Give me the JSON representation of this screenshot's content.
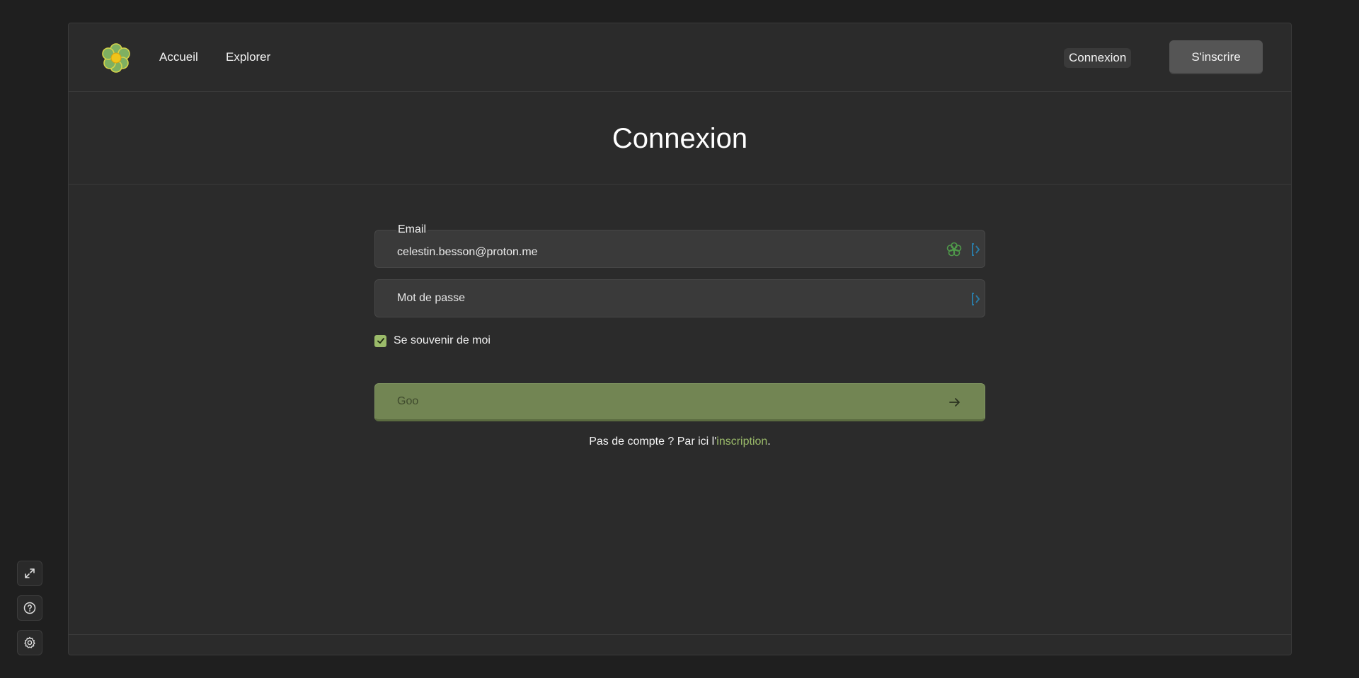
{
  "nav": {
    "home": "Accueil",
    "explore": "Explorer",
    "login": "Connexion",
    "signup": "S'inscrire"
  },
  "page": {
    "title": "Connexion"
  },
  "form": {
    "email": {
      "label": "Email",
      "value": "celestin.besson@proton.me"
    },
    "password": {
      "placeholder": "Mot de passe",
      "value": ""
    },
    "remember": {
      "label": "Se souvenir de moi",
      "checked": true
    },
    "submit_label": "Goo"
  },
  "signup_hint": {
    "prefix": "Pas de compte ? Par ici l'",
    "link": "inscription",
    "suffix": "."
  },
  "icons": {
    "logo": "flower-logo-icon",
    "password_manager": "flower-icon",
    "autofill": "bracket-icon",
    "submit": "arrow-right-icon",
    "tools": [
      "expand-icon",
      "help-circle-icon",
      "gear-icon"
    ]
  },
  "colors": {
    "accent": "#9bbb6a",
    "submit_bg": "#728553",
    "page_bg": "#2b2b2b",
    "outer_bg": "#1f1f1f"
  }
}
